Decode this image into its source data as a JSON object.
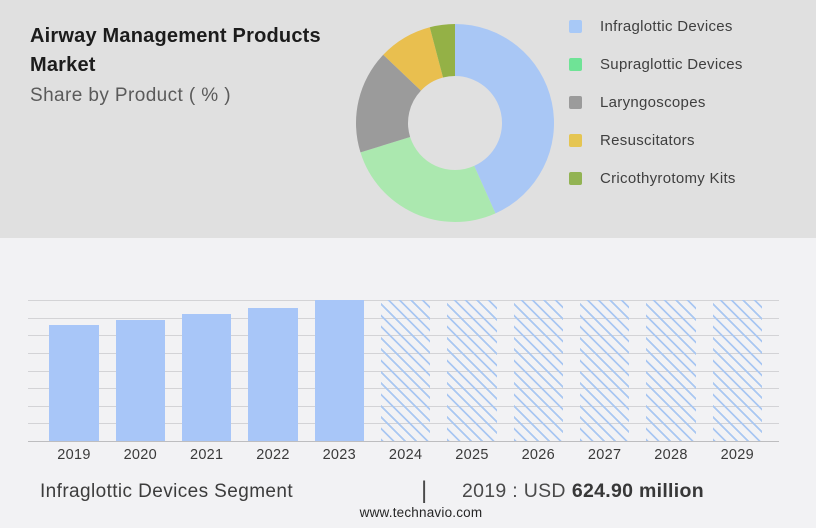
{
  "page": {
    "website": "www.technavio.com",
    "colors": {
      "top_panel_bg": "#E0E0E0",
      "bottom_panel_bg": "#F2F2F4",
      "gridline": "#D3D3D6",
      "axis_baseline": "#BDBDBF"
    }
  },
  "header": {
    "title_line1": "Airway Management Products",
    "title_line2": "Market",
    "subtitle": "Share by Product ( % )"
  },
  "chart_data": [
    {
      "type": "pie",
      "style": "donut",
      "title": "Share by Product ( % )",
      "legend_position": "right",
      "slices": [
        {
          "label": "Infraglottic Devices",
          "value_pct": 43.3,
          "color": "#A9C7F5",
          "legend_color": "#A8C9F7"
        },
        {
          "label": "Supraglottic Devices",
          "value_pct": 26.9,
          "color": "#ABE8AF",
          "legend_color": "#6FE396"
        },
        {
          "label": "Laryngoscopes",
          "value_pct": 16.9,
          "color": "#9B9B9B",
          "legend_color": "#9B9B9B"
        },
        {
          "label": "Resuscitators",
          "value_pct": 8.8,
          "color": "#E9BF4F",
          "legend_color": "#E5C552"
        },
        {
          "label": "Cricothyrotomy Kits",
          "value_pct": 4.1,
          "color": "#94B146",
          "legend_color": "#92B353"
        }
      ]
    },
    {
      "type": "bar",
      "title": "Infraglottic Devices Segment",
      "x": [
        "2019",
        "2020",
        "2021",
        "2022",
        "2023",
        "2024",
        "2025",
        "2026",
        "2027",
        "2028",
        "2029"
      ],
      "values_relative": [
        0.82,
        0.86,
        0.9,
        0.945,
        1,
        1,
        1,
        1,
        1,
        1,
        1
      ],
      "forecast_from": "2024",
      "known_values": {
        "2019": "USD 624.90 million"
      },
      "bar_color": "#A8C6F8",
      "forecast_hatch_color": "#A9C7F2",
      "gridline_count": 9,
      "ylim_relative": [
        0,
        1
      ],
      "grid": true
    }
  ],
  "footer": {
    "segment_label": "Infraglottic Devices Segment",
    "separator": "|",
    "value_prefix": "2019 : USD",
    "value_bold": "624.90 million"
  }
}
